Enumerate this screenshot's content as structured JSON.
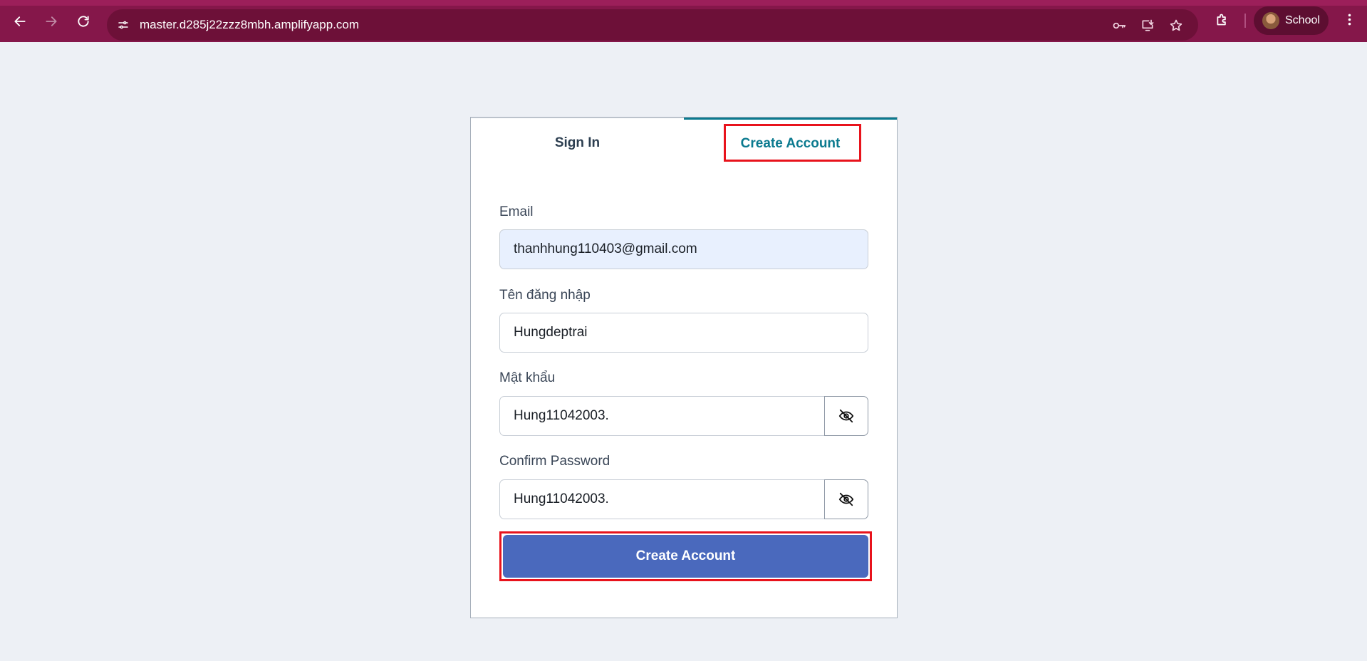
{
  "browser": {
    "url": "master.d285j22zzz8mbh.amplifyapp.com",
    "profile_name": "School",
    "icons": [
      "back-icon",
      "forward-icon",
      "reload-icon",
      "site-info-icon",
      "password-key-icon",
      "install-app-icon",
      "bookmark-star-icon",
      "extensions-icon",
      "menu-icon"
    ]
  },
  "auth": {
    "tabs": {
      "sign_in": "Sign In",
      "create_account": "Create Account"
    },
    "active_tab": "create_account",
    "fields": {
      "email": {
        "label": "Email",
        "value": "thanhhung110403@gmail.com"
      },
      "username": {
        "label": "Tên đăng nhập",
        "value": "Hungdeptrai"
      },
      "password": {
        "label": "Mật khẩu",
        "value": "Hung11042003."
      },
      "confirm_password": {
        "label": "Confirm Password",
        "value": "Hung11042003."
      }
    },
    "submit_label": "Create Account"
  },
  "colors": {
    "browser_frame": "#85174a",
    "accent_tab": "#0b7a8f",
    "primary_button": "#4a69bd",
    "highlight_box": "#e8131c",
    "page_background": "#edf0f5"
  }
}
